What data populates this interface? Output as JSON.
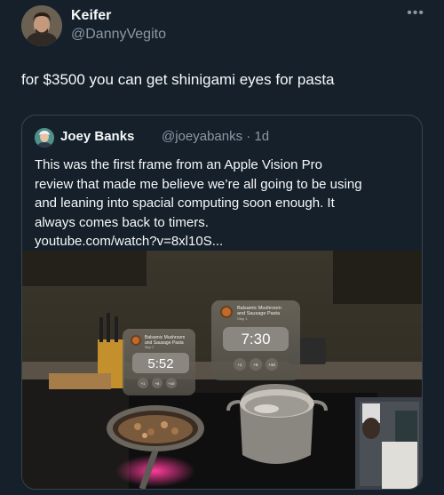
{
  "author": {
    "name": "Keifer",
    "handle": "@DannyVegito",
    "more_icon": "more-dots-icon"
  },
  "tweet": {
    "text": "for $3500 you can get shinigami eyes for pasta"
  },
  "quoted": {
    "name": "Joey Banks",
    "handle": "@joeyabanks · 1d",
    "text_lines": [
      "This was the first frame from an Apple Vision Pro",
      "review that made me believe we’re all going to be using",
      "and leaning into spacial computing soon enough. It",
      "always comes back to timers.",
      "youtube.com/watch?v=8xl10S..."
    ]
  },
  "image": {
    "panel_left": {
      "title_line1": "Balsamic Mushroom",
      "title_line2": "and Sausage Pasta",
      "step": "Step 2",
      "time": "5:52",
      "controls": [
        "+1",
        "+5",
        "+10"
      ]
    },
    "panel_right": {
      "title_line1": "Balsamic Mushroom",
      "title_line2": "and Sausage Pasta",
      "step": "Step 1",
      "time": "7:30",
      "controls": [
        "+1",
        "+5",
        "+10"
      ]
    }
  }
}
